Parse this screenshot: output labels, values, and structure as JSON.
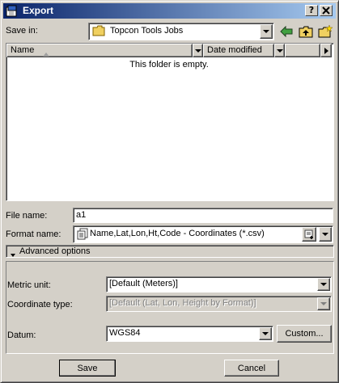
{
  "window": {
    "title": "Export",
    "help_button": "?",
    "close_button": "X"
  },
  "save_in": {
    "label": "Save in:",
    "value": "Topcon Tools Jobs",
    "icon": "folder-icon"
  },
  "toolbar": {
    "back_icon": "back-arrow-icon",
    "up_icon": "up-folder-icon",
    "new_folder_icon": "new-folder-icon"
  },
  "file_list": {
    "columns": [
      "Name",
      "Date modified"
    ],
    "empty_message": "This folder is empty."
  },
  "file_name": {
    "label": "File name:",
    "value": "a1"
  },
  "format_name": {
    "label": "Format name:",
    "value": "Name,Lat,Lon,Ht,Code - Coordinates (*.csv)"
  },
  "advanced": {
    "label": "Advanced options"
  },
  "metric_unit": {
    "label": "Metric unit:",
    "value": "[Default (Meters)]"
  },
  "coordinate_type": {
    "label": "Coordinate type:",
    "value": "[Default (Lat, Lon, Height by Format)]"
  },
  "datum": {
    "label": "Datum:",
    "value": "WGS84",
    "custom_button": "Custom..."
  },
  "actions": {
    "save": "Save",
    "cancel": "Cancel"
  },
  "colors": {
    "titlebar_start": "#0a246a",
    "titlebar_end": "#a6caf0",
    "face": "#d4d0c8"
  }
}
